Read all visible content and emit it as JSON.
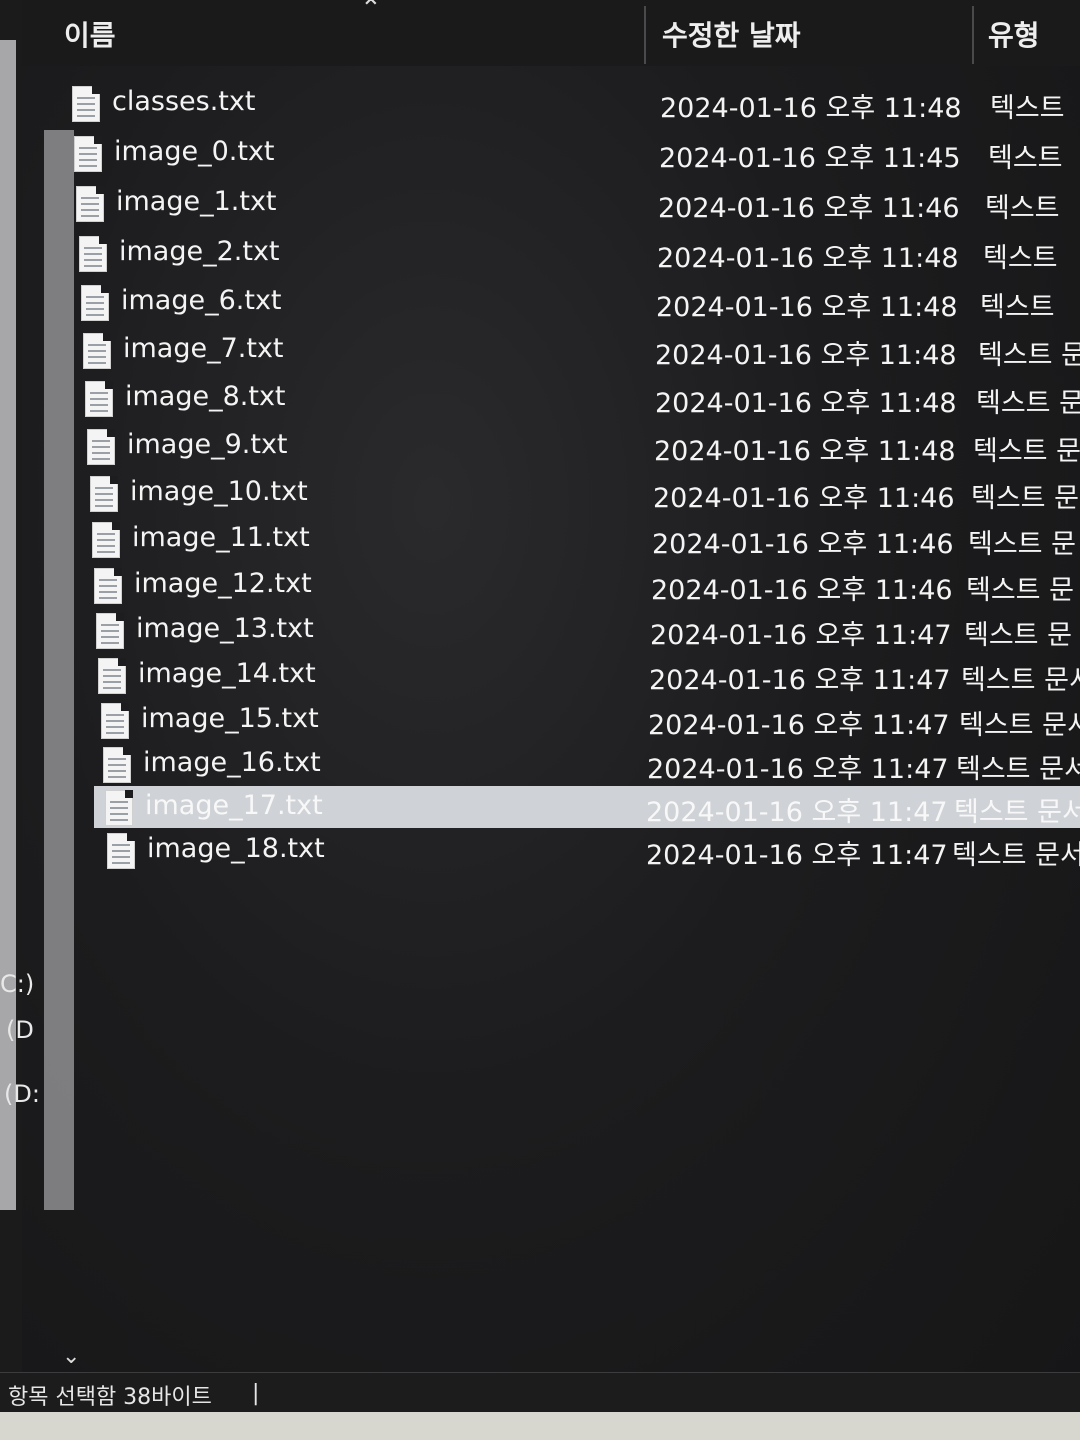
{
  "columns": {
    "name": "이름",
    "date": "수정한 날짜",
    "type": "유형"
  },
  "files": [
    {
      "name": "classes.txt",
      "date": "2024-01-16 오후 11:48",
      "type": "텍스트"
    },
    {
      "name": "image_0.txt",
      "date": "2024-01-16 오후 11:45",
      "type": "텍스트"
    },
    {
      "name": "image_1.txt",
      "date": "2024-01-16 오후 11:46",
      "type": "텍스트"
    },
    {
      "name": "image_2.txt",
      "date": "2024-01-16 오후 11:48",
      "type": "텍스트"
    },
    {
      "name": "image_6.txt",
      "date": "2024-01-16 오후 11:48",
      "type": "텍스트"
    },
    {
      "name": "image_7.txt",
      "date": "2024-01-16 오후 11:48",
      "type": "텍스트 문"
    },
    {
      "name": "image_8.txt",
      "date": "2024-01-16 오후 11:48",
      "type": "텍스트 문"
    },
    {
      "name": "image_9.txt",
      "date": "2024-01-16 오후 11:48",
      "type": "텍스트 문"
    },
    {
      "name": "image_10.txt",
      "date": "2024-01-16 오후 11:46",
      "type": "텍스트 문"
    },
    {
      "name": "image_11.txt",
      "date": "2024-01-16 오후 11:46",
      "type": "텍스트 문"
    },
    {
      "name": "image_12.txt",
      "date": "2024-01-16 오후 11:46",
      "type": "텍스트 문"
    },
    {
      "name": "image_13.txt",
      "date": "2024-01-16 오후 11:47",
      "type": "텍스트 문"
    },
    {
      "name": "image_14.txt",
      "date": "2024-01-16 오후 11:47",
      "type": "텍스트 문서"
    },
    {
      "name": "image_15.txt",
      "date": "2024-01-16 오후 11:47",
      "type": "텍스트 문서"
    },
    {
      "name": "image_16.txt",
      "date": "2024-01-16 오후 11:47",
      "type": "텍스트 문서"
    },
    {
      "name": "image_17.txt",
      "date": "2024-01-16 오후 11:47",
      "type": "텍스트 문서",
      "selected": true
    },
    {
      "name": "image_18.txt",
      "date": "2024-01-16 오후 11:47",
      "type": "텍스트 문서"
    }
  ],
  "nav": {
    "drive_c": "C:)",
    "drive_d1": "(D",
    "drive_d2": "(D:"
  },
  "status": {
    "text": "항목 선택함 38바이트",
    "separator": "|"
  },
  "colors": {
    "background": "#1d1d1f",
    "selected_row": "#cfd2d6",
    "text": "#f4f4f4"
  },
  "icons": {
    "sort": "chevron-up-icon",
    "file": "text-file-icon",
    "scroll_down": "chevron-down-icon"
  }
}
